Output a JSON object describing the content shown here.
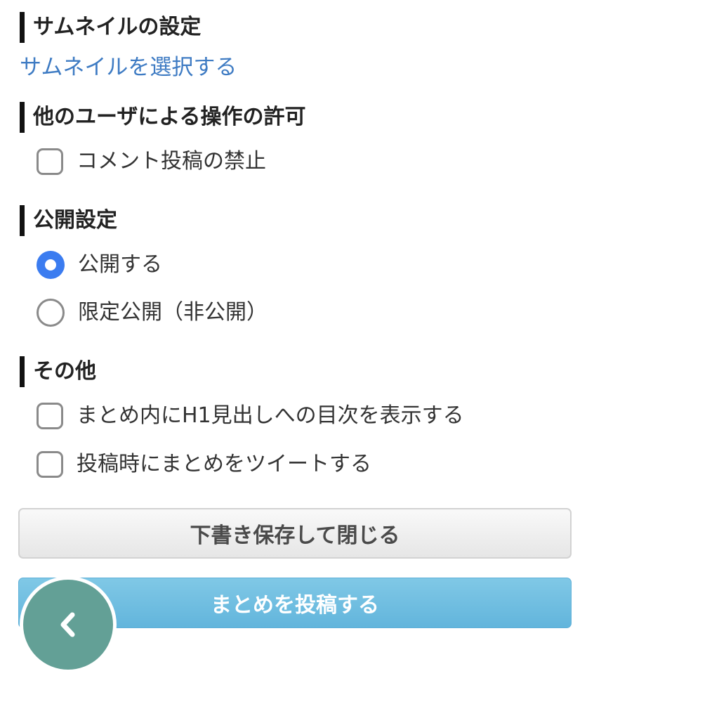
{
  "thumbnail": {
    "heading": "サムネイルの設定",
    "select_link": "サムネイルを選択する"
  },
  "permissions": {
    "heading": "他のユーザによる操作の許可",
    "options": [
      {
        "label": "コメント投稿の禁止",
        "checked": false
      }
    ]
  },
  "visibility": {
    "heading": "公開設定",
    "options": [
      {
        "label": "公開する",
        "selected": true
      },
      {
        "label": "限定公開（非公開）",
        "selected": false
      }
    ]
  },
  "other": {
    "heading": "その他",
    "options": [
      {
        "label": "まとめ内にH1見出しへの目次を表示する",
        "checked": false
      },
      {
        "label": "投稿時にまとめをツイートする",
        "checked": false
      }
    ]
  },
  "buttons": {
    "save_draft": "下書き保存して閉じる",
    "post": "まとめを投稿する"
  },
  "fab": {
    "icon": "chevron-left-icon"
  },
  "colors": {
    "link": "#3e7bc3",
    "radio_selected": "#3b7cf0",
    "post_button": "#6cbde2",
    "fab": "#63a096"
  }
}
